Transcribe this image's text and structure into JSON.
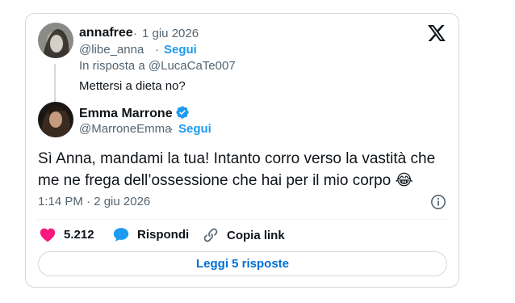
{
  "reply_to_tweet": {
    "display_name": "annafree",
    "separator": "·",
    "date": "1 giu 2026",
    "handle": "@libe_anna",
    "follow_label": "Segui",
    "in_reply_to": "In risposta a @LucaCaTe007",
    "text": "Mettersi a dieta no?"
  },
  "main_tweet": {
    "display_name": "Emma Marrone",
    "handle": "@MarroneEmma",
    "separator": "·",
    "follow_label": "Segui",
    "text": "Sì Anna, mandami la tua! Intanto corro verso la vastità che me ne frega dell’ossessione che hai per il mio corpo 😂",
    "timestamp": "1:14 PM · 2 giu 2026"
  },
  "actions": {
    "like_count": "5.212",
    "reply_label": "Rispondi",
    "copy_link_label": "Copia link"
  },
  "read_replies_label": "Leggi 5 risposte",
  "icons": {
    "logo": "x-logo-icon",
    "verified": "verified-badge-icon",
    "info": "info-icon",
    "like": "heart-icon",
    "reply": "speech-bubble-icon",
    "copy": "link-icon"
  },
  "colors": {
    "accent": "#1d9bf0",
    "like": "#f91880",
    "muted": "#536471",
    "border": "#cfd9de"
  }
}
